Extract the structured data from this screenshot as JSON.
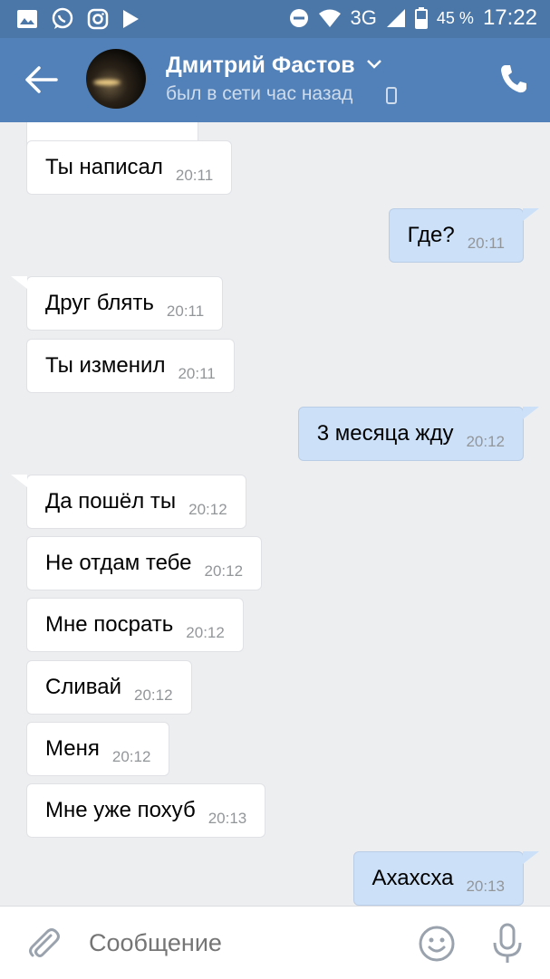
{
  "status_bar": {
    "battery_percent": "45 %",
    "network": "3G",
    "time": "17:22"
  },
  "header": {
    "contact_name": "Дмитрий Фастов",
    "contact_status": "был в сети час назад"
  },
  "messages": [
    {
      "side": "in",
      "text": "Ты написал",
      "time": "20:11"
    },
    {
      "side": "out",
      "text": "Где?",
      "time": "20:11"
    },
    {
      "side": "in",
      "text": "Друг блять",
      "time": "20:11"
    },
    {
      "side": "in",
      "text": "Ты изменил",
      "time": "20:11"
    },
    {
      "side": "out",
      "text": "3 месяца жду",
      "time": "20:12"
    },
    {
      "side": "in",
      "text": "Да пошёл ты",
      "time": "20:12"
    },
    {
      "side": "in",
      "text": "Не отдам тебе",
      "time": "20:12"
    },
    {
      "side": "in",
      "text": "Мне посрать",
      "time": "20:12"
    },
    {
      "side": "in",
      "text": "Сливай",
      "time": "20:12"
    },
    {
      "side": "in",
      "text": "Меня",
      "time": "20:12"
    },
    {
      "side": "in",
      "text": "Мне уже похуб",
      "time": "20:13"
    },
    {
      "side": "out",
      "text": "Ахахсха",
      "time": "20:13"
    }
  ],
  "composer": {
    "placeholder": "Сообщение"
  },
  "colors": {
    "header": "#5181b8",
    "status_bar": "#4a76a8",
    "incoming_bubble": "#ffffff",
    "outgoing_bubble": "#cce0f8",
    "background": "#edeef0"
  }
}
